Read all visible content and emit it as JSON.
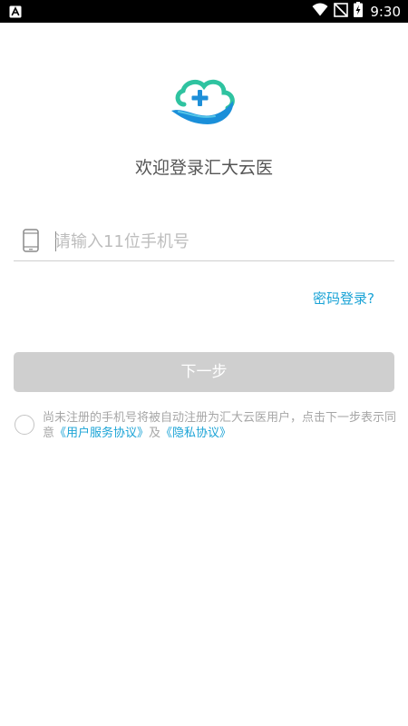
{
  "status_bar": {
    "time": "9:30",
    "icons": [
      "notification-a-icon",
      "wifi-icon",
      "no-signal-icon",
      "battery-charging-icon"
    ]
  },
  "logo": {
    "icon": "cloud-plus-logo-icon",
    "colors": {
      "green": "#2fc3a0",
      "blue": "#1a8fd9"
    }
  },
  "welcome_text": "欢迎登录汇大云医",
  "phone_input": {
    "icon": "mobile-phone-icon",
    "placeholder": "请输入11位手机号",
    "value": ""
  },
  "password_login_link": "密码登录?",
  "next_button_label": "下一步",
  "agreement": {
    "text_line": "尚未注册的手机号将被自动注册为汇大云医用户，点击下一步表示同意",
    "user_service_link": "《用户服务协议》",
    "conjunction": "及",
    "privacy_link": "《隐私协议》",
    "checked": false
  },
  "colors": {
    "accent": "#1aa3d6",
    "button_disabled": "#cfcfcf",
    "text_gray": "#555555",
    "hint_gray": "#a6a6a6"
  }
}
